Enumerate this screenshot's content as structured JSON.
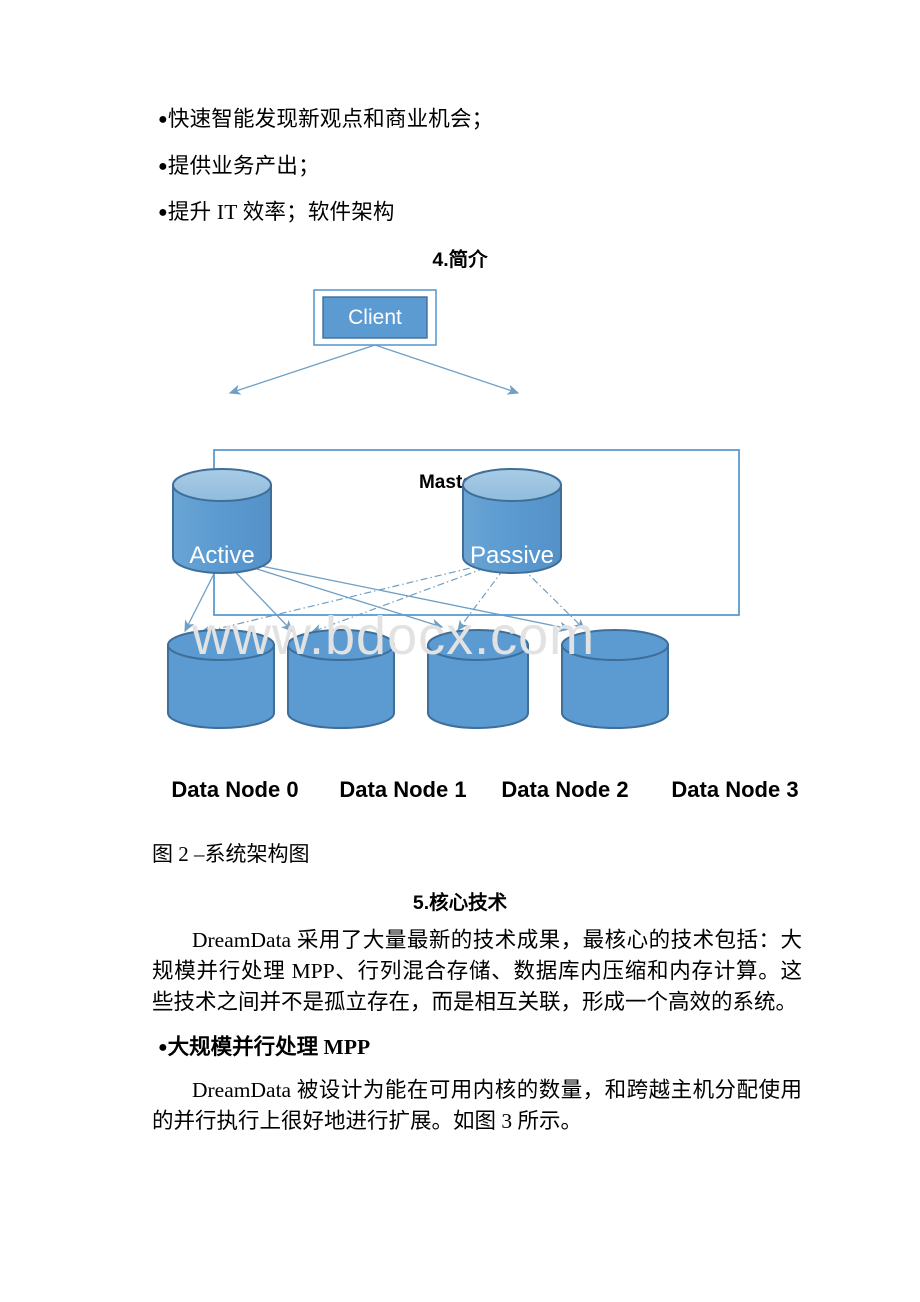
{
  "document": {
    "bullets_top": [
      "快速智能发现新观点和商业机会；",
      "提供业务产出；",
      "提升 IT 效率；软件架构"
    ],
    "heading_intro": "4.简介",
    "figure_caption": "图 2 –系统架构图",
    "heading_core_tech": "5.核心技术",
    "paragraph_core_tech": "DreamData 采用了大量最新的技术成果，最核心的技术包括：大规模并行处理 MPP、行列混合存储、数据库内压缩和内存计算。这些技术之间并不是孤立存在，而是相互关联，形成一个高效的系统。",
    "bullet_mpp": "大规模并行处理 MPP",
    "paragraph_mpp": "DreamData 被设计为能在可用内核的数量，和跨越主机分配使用的并行执行上很好地进行扩展。如图 3 所示。",
    "bullet_marker": "●",
    "watermark": "www.bdocx.com"
  },
  "diagram": {
    "client_label": "Client",
    "master_node_label": "Master Node",
    "active_label": "Active",
    "passive_label": "Passive",
    "data_nodes": [
      "Data Node 0",
      "Data Node 1",
      "Data Node 2",
      "Data Node 3"
    ],
    "colors": {
      "fill_blue": "#5b9bd1",
      "top_light": "#9dc5e2",
      "stroke_dark": "#3f6f99",
      "frame_blue": "#5b9bd1",
      "connector": "#6f9fc4",
      "label_dark": "#000000",
      "watermark_gray": "#e2e2e2"
    }
  }
}
